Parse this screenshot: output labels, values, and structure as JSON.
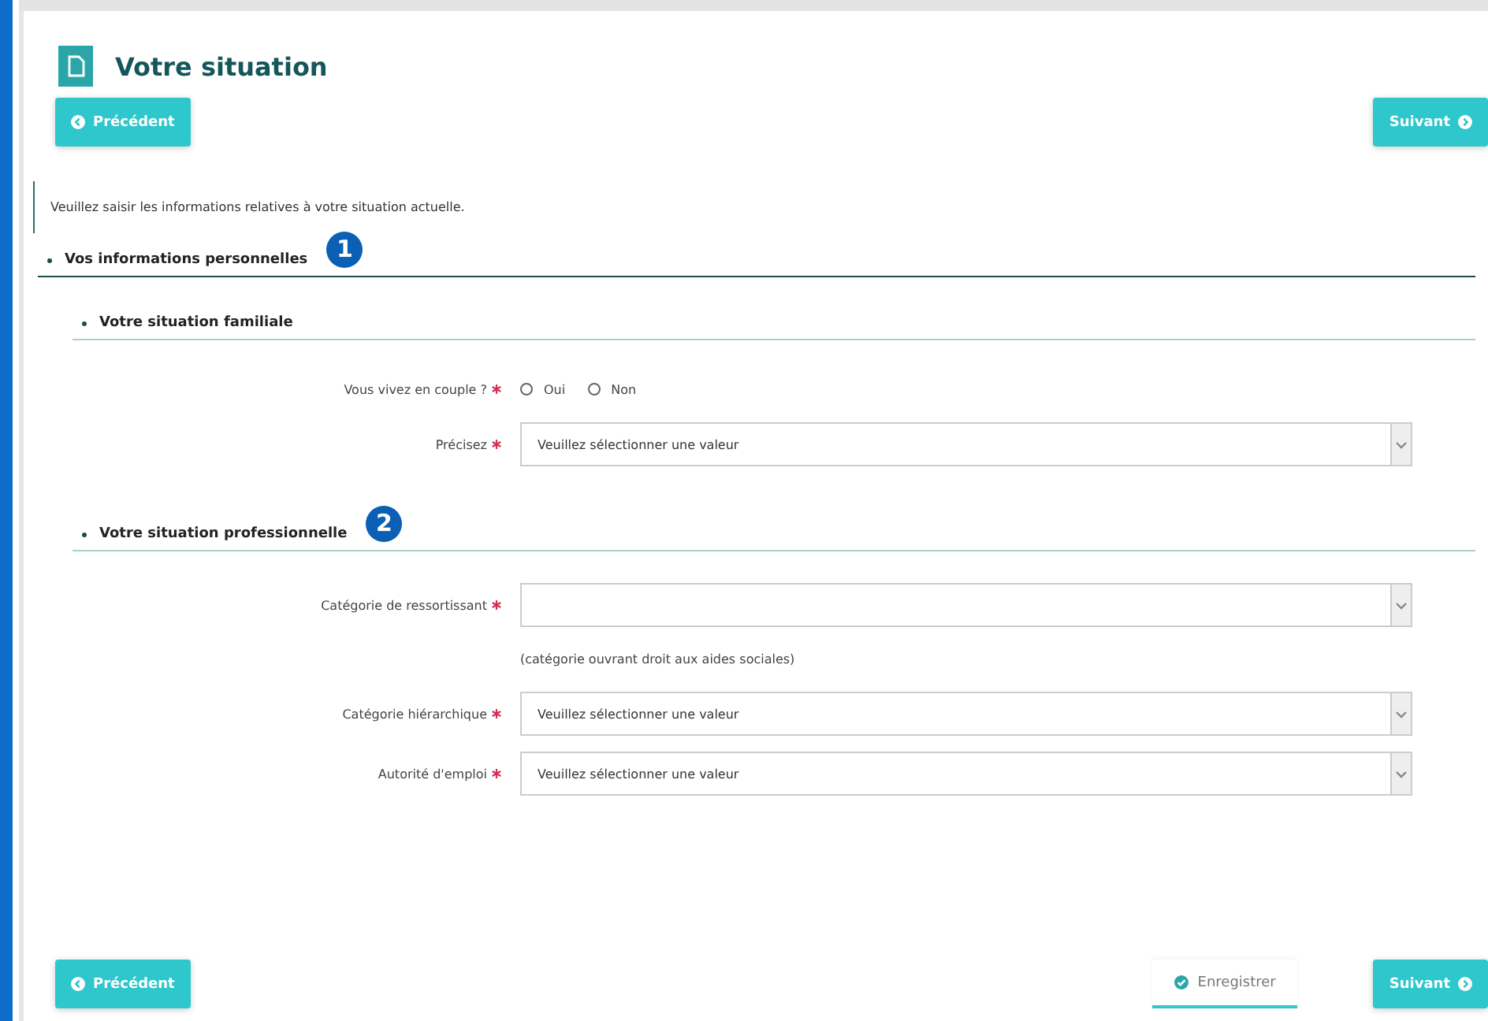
{
  "page": {
    "title": "Votre situation"
  },
  "top_buttons": {
    "previous": "Précédent",
    "next": "Suivant"
  },
  "intro": "Veuillez saisir les informations relatives à votre situation actuelle.",
  "section": {
    "title": "Vos informations personnelles",
    "marker": "1",
    "subsections": [
      {
        "title": "Votre situation familiale",
        "fields": [
          {
            "kind": "radio",
            "label": "Vous vivez en couple ?",
            "required": true,
            "options": [
              {
                "label": "Oui",
                "selected": false
              },
              {
                "label": "Non",
                "selected": false
              }
            ]
          },
          {
            "kind": "select",
            "label": "Précisez",
            "required": true,
            "placeholder": "Veuillez sélectionner une valeur"
          }
        ]
      },
      {
        "title": "Votre situation professionnelle",
        "marker": "2",
        "fields": [
          {
            "kind": "select",
            "label": "Catégorie de ressortissant",
            "required": true,
            "hint": "(catégorie ouvrant droit aux aides sociales)"
          },
          {
            "kind": "select",
            "label": "Catégorie hiérarchique",
            "required": true,
            "placeholder": "Veuillez sélectionner une valeur"
          },
          {
            "kind": "select",
            "label": "Autorité d'emploi",
            "required": true,
            "placeholder": "Veuillez sélectionner une valeur"
          }
        ]
      }
    ]
  },
  "bottom_buttons": {
    "previous": "Précédent",
    "save": "Enregistrer",
    "next": "Suivant"
  }
}
